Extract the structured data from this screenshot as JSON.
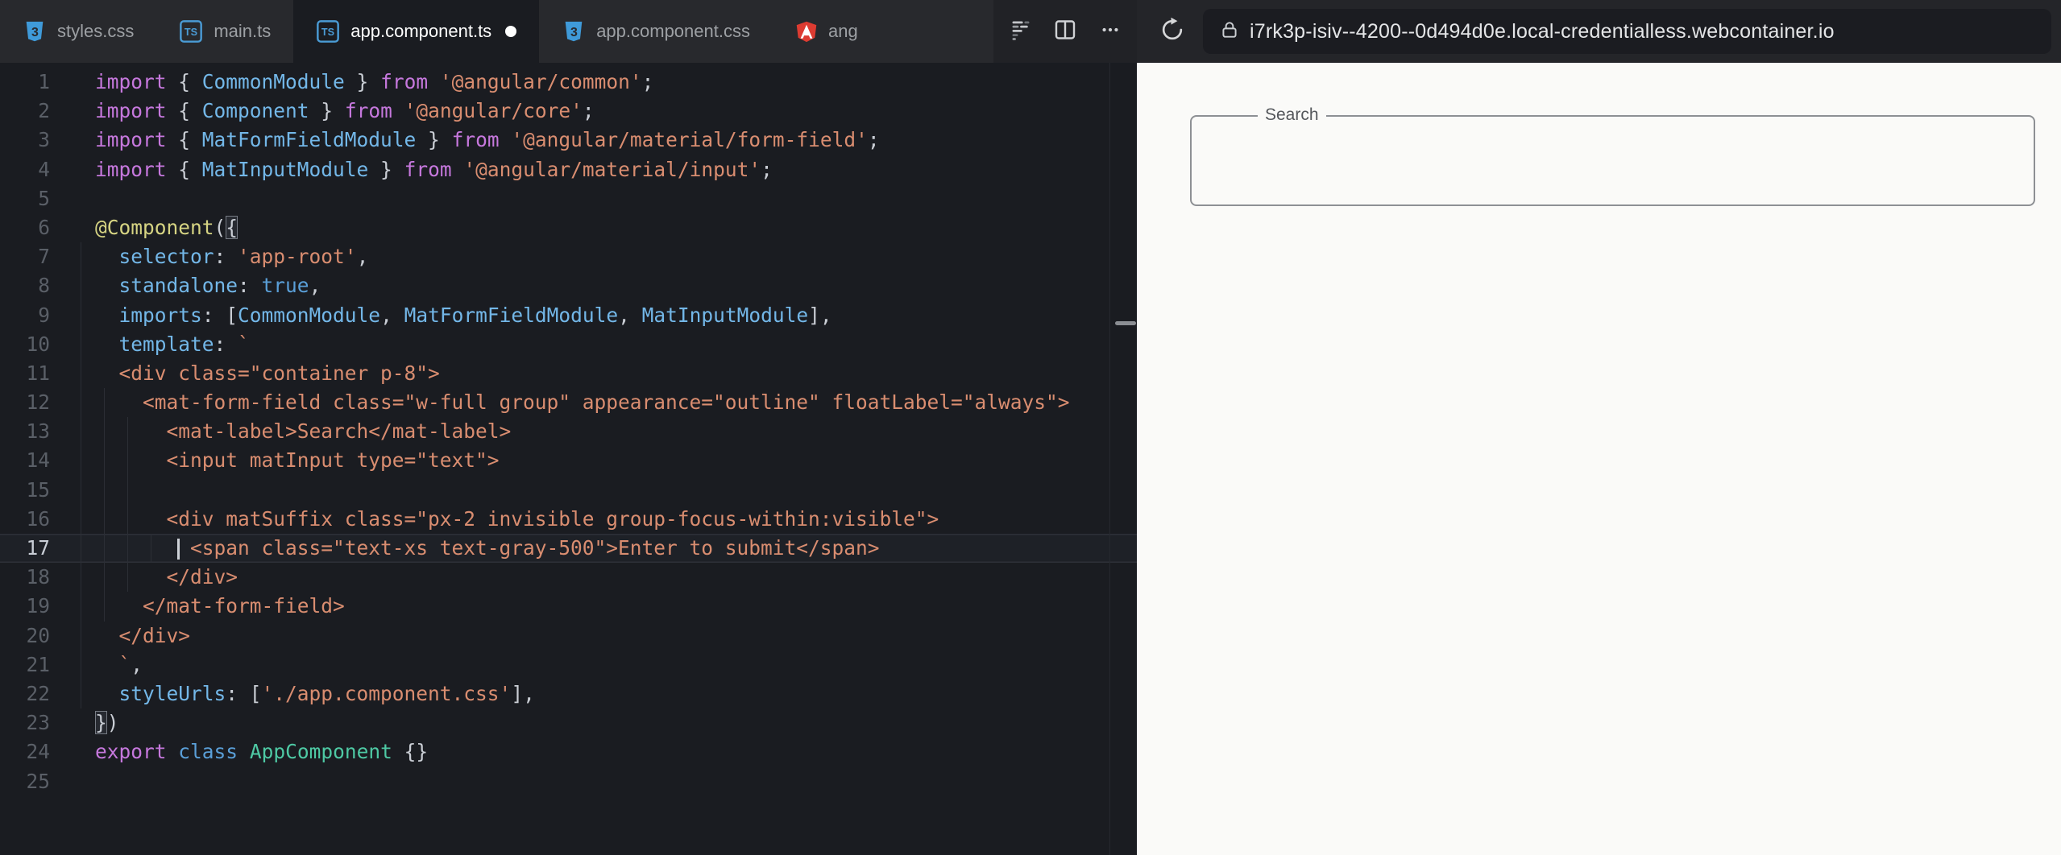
{
  "editor": {
    "tabs": [
      {
        "label": "styles.css",
        "icon": "css",
        "active": false,
        "dirty": false
      },
      {
        "label": "main.ts",
        "icon": "ts",
        "active": false,
        "dirty": false
      },
      {
        "label": "app.component.ts",
        "icon": "ts",
        "active": true,
        "dirty": true
      },
      {
        "label": "app.component.css",
        "icon": "css",
        "active": false,
        "dirty": false
      },
      {
        "label": "ang",
        "icon": "angular",
        "active": false,
        "dirty": false
      }
    ],
    "controls": {
      "icons": [
        "prettier-icon",
        "split-view-icon",
        "more-options-icon"
      ]
    },
    "active_line": 17,
    "cursor": {
      "line": 17,
      "col": 7
    },
    "colors": {
      "background": "#1a1c21",
      "tabbar": "#28292d",
      "keyword": "#c678dd",
      "identifier": "#73b7e8",
      "string": "#d98d70",
      "decorator": "#d6d483",
      "boolean_kw": "#5a9fd8",
      "class_name": "#4ec9a4"
    },
    "lines": [
      {
        "n": 1,
        "s": [
          [
            "kw",
            "import"
          ],
          [
            "pn",
            " { "
          ],
          [
            "id",
            "CommonModule"
          ],
          [
            "pn",
            " } "
          ],
          [
            "kw",
            "from"
          ],
          [
            "pn",
            " "
          ],
          [
            "st",
            "'@angular/common'"
          ],
          [
            "pn",
            ";"
          ]
        ]
      },
      {
        "n": 2,
        "s": [
          [
            "kw",
            "import"
          ],
          [
            "pn",
            " { "
          ],
          [
            "id",
            "Component"
          ],
          [
            "pn",
            " } "
          ],
          [
            "kw",
            "from"
          ],
          [
            "pn",
            " "
          ],
          [
            "st",
            "'@angular/core'"
          ],
          [
            "pn",
            ";"
          ]
        ]
      },
      {
        "n": 3,
        "s": [
          [
            "kw",
            "import"
          ],
          [
            "pn",
            " { "
          ],
          [
            "id",
            "MatFormFieldModule"
          ],
          [
            "pn",
            " } "
          ],
          [
            "kw",
            "from"
          ],
          [
            "pn",
            " "
          ],
          [
            "st",
            "'@angular/material/form-field'"
          ],
          [
            "pn",
            ";"
          ]
        ]
      },
      {
        "n": 4,
        "s": [
          [
            "kw",
            "import"
          ],
          [
            "pn",
            " { "
          ],
          [
            "id",
            "MatInputModule"
          ],
          [
            "pn",
            " } "
          ],
          [
            "kw",
            "from"
          ],
          [
            "pn",
            " "
          ],
          [
            "st",
            "'@angular/material/input'"
          ],
          [
            "pn",
            ";"
          ]
        ]
      },
      {
        "n": 5,
        "s": []
      },
      {
        "n": 6,
        "s": [
          [
            "dec",
            "@Component"
          ],
          [
            "pn",
            "("
          ],
          [
            "bm",
            "{"
          ]
        ]
      },
      {
        "n": 7,
        "s": [
          [
            "pn",
            "  "
          ],
          [
            "id",
            "selector"
          ],
          [
            "pn",
            ": "
          ],
          [
            "st",
            "'app-root'"
          ],
          [
            "pn",
            ","
          ]
        ]
      },
      {
        "n": 8,
        "s": [
          [
            "pn",
            "  "
          ],
          [
            "id",
            "standalone"
          ],
          [
            "pn",
            ": "
          ],
          [
            "bo",
            "true"
          ],
          [
            "pn",
            ","
          ]
        ]
      },
      {
        "n": 9,
        "s": [
          [
            "pn",
            "  "
          ],
          [
            "id",
            "imports"
          ],
          [
            "pn",
            ": ["
          ],
          [
            "id",
            "CommonModule"
          ],
          [
            "pn",
            ", "
          ],
          [
            "id",
            "MatFormFieldModule"
          ],
          [
            "pn",
            ", "
          ],
          [
            "id",
            "MatInputModule"
          ],
          [
            "pn",
            "],"
          ]
        ]
      },
      {
        "n": 10,
        "s": [
          [
            "pn",
            "  "
          ],
          [
            "id",
            "template"
          ],
          [
            "pn",
            ": "
          ],
          [
            "st",
            "`"
          ]
        ]
      },
      {
        "n": 11,
        "s": [
          [
            "st",
            "  <div class=\"container p-8\">"
          ]
        ]
      },
      {
        "n": 12,
        "s": [
          [
            "st",
            "    <mat-form-field class=\"w-full group\" appearance=\"outline\" floatLabel=\"always\">"
          ]
        ]
      },
      {
        "n": 13,
        "s": [
          [
            "st",
            "      <mat-label>Search</mat-label>"
          ]
        ]
      },
      {
        "n": 14,
        "s": [
          [
            "st",
            "      <input matInput type=\"text\">"
          ]
        ]
      },
      {
        "n": 15,
        "s": []
      },
      {
        "n": 16,
        "s": [
          [
            "st",
            "      <div matSuffix class=\"px-2 invisible group-focus-within:visible\">"
          ]
        ]
      },
      {
        "n": 17,
        "s": [
          [
            "st",
            "        <span class=\"text-xs text-gray-500\">Enter to submit</span>"
          ]
        ]
      },
      {
        "n": 18,
        "s": [
          [
            "st",
            "      </div>"
          ]
        ]
      },
      {
        "n": 19,
        "s": [
          [
            "st",
            "    </mat-form-field>"
          ]
        ]
      },
      {
        "n": 20,
        "s": [
          [
            "st",
            "  </div>"
          ]
        ]
      },
      {
        "n": 21,
        "s": [
          [
            "st",
            "  `"
          ],
          [
            "pn",
            ","
          ]
        ]
      },
      {
        "n": 22,
        "s": [
          [
            "pn",
            "  "
          ],
          [
            "id",
            "styleUrls"
          ],
          [
            "pn",
            ": ["
          ],
          [
            "st",
            "'./app.component.css'"
          ],
          [
            "pn",
            "],"
          ]
        ]
      },
      {
        "n": 23,
        "s": [
          [
            "bm",
            "}"
          ],
          [
            "pn",
            ")"
          ]
        ]
      },
      {
        "n": 24,
        "s": [
          [
            "kw",
            "export"
          ],
          [
            "pn",
            " "
          ],
          [
            "bo",
            "class"
          ],
          [
            "pn",
            " "
          ],
          [
            "cl",
            "AppComponent"
          ],
          [
            "pn",
            " {}"
          ]
        ]
      },
      {
        "n": 25,
        "s": []
      }
    ]
  },
  "preview": {
    "toolbar": {
      "icons": [
        "refresh-icon",
        "lock-icon"
      ],
      "url": "i7rk3p-isiv--4200--0d494d0e.local-credentialless.webcontainer.io"
    },
    "search_field": {
      "label": "Search",
      "value": ""
    }
  }
}
